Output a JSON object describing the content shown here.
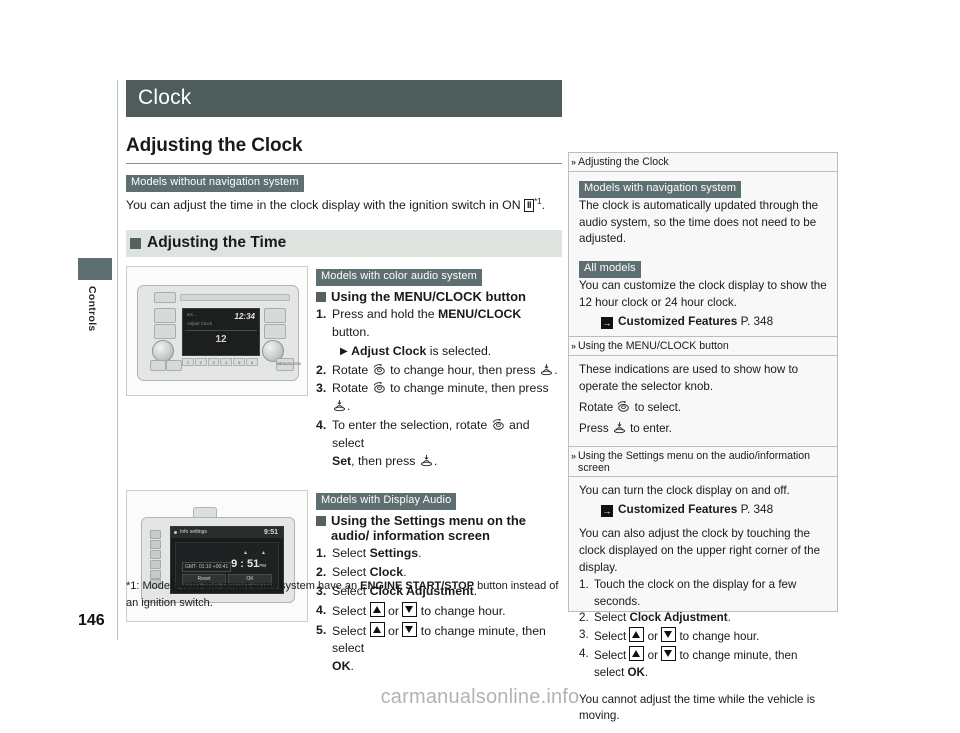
{
  "page": {
    "number": "146",
    "side_tab": "Controls",
    "chapter": "Clock",
    "watermark": "carmanualsonline.info"
  },
  "main": {
    "section_title": "Adjusting the Clock",
    "tag_without_nav": "Models without navigation system",
    "intro_pre": "You can adjust the time in the clock display with the ignition switch in ON ",
    "intro_box": "II",
    "intro_fn": "*1",
    "intro_post": ".",
    "subsection_title": "Adjusting the Time",
    "block_color_audio": {
      "tag": "Models with color audio system",
      "heading": "Using the MENU/CLOCK button",
      "steps": [
        {
          "num": "1.",
          "pre": "Press and hold the ",
          "bold": "MENU/CLOCK",
          "post": " button."
        },
        {
          "num": "2.",
          "pre": "Rotate ",
          "icon": "selector-knob-rotate-icon",
          "post": " to change hour, then press ",
          "icon2": "selector-knob-press-icon",
          "tail": "."
        },
        {
          "num": "3.",
          "pre": "Rotate ",
          "icon": "selector-knob-rotate-icon",
          "post": " to change minute, then press ",
          "icon2": "selector-knob-press-icon",
          "tail": "."
        },
        {
          "num": "4.",
          "pre": "To enter the selection, rotate ",
          "icon": "selector-knob-rotate-icon",
          "post": " and select ",
          "bold": "Set",
          "tail": ", then press ",
          "icon2": "selector-knob-press-icon",
          "end": "."
        }
      ],
      "substep_pre": "",
      "substep_bold": "Adjust Clock",
      "substep_post": " is selected."
    },
    "block_display_audio": {
      "tag": "Models with Display Audio",
      "heading": "Using the Settings menu on the audio/ information screen",
      "steps": [
        {
          "num": "1.",
          "pre": "Select ",
          "bold": "Settings",
          "post": "."
        },
        {
          "num": "2.",
          "pre": "Select ",
          "bold": "Clock",
          "post": "."
        },
        {
          "num": "3.",
          "pre": "Select ",
          "bold": "Clock Adjustment",
          "post": "."
        },
        {
          "num": "4.",
          "pre": "Select ",
          "updown": true,
          "post": " to change hour."
        },
        {
          "num": "5.",
          "pre": "Select ",
          "updown": true,
          "post": " to change minute, then select ",
          "bold": "OK",
          "tail": "."
        }
      ]
    },
    "footnote_pre": "*1: Models with the smart entry system have an ",
    "footnote_bold": "ENGINE START/STOP",
    "footnote_post": " button instead of an ignition switch."
  },
  "illustrations": {
    "color_audio": {
      "screen_time": "12:34",
      "screen_label": "Adjust Clock",
      "screen_icon": "src…",
      "screen_center": "12",
      "presets": [
        "1",
        "2",
        "3",
        "4",
        "5",
        "6"
      ],
      "menu_button": "MENU/CLOCK"
    },
    "display_audio": {
      "bar_title": "Info settings",
      "bar_time": "9:51",
      "gmt": "GMT- 01:10 +00:41",
      "clock": "9 : 51",
      "clock_suffix": "PM",
      "reset_label": "Reset",
      "ok_label": "OK"
    }
  },
  "aside": {
    "groups": [
      {
        "head": "Adjusting the Clock",
        "blocks": [
          {
            "type": "tag",
            "text": "Models with navigation system"
          },
          {
            "type": "p",
            "text": "The clock is automatically updated through the audio system, so the time does not need to be adjusted."
          },
          {
            "type": "gap"
          },
          {
            "type": "tag",
            "text": "All models"
          },
          {
            "type": "p",
            "text": "You can customize the clock display to show the 12 hour clock or 24 hour clock."
          },
          {
            "type": "ref",
            "bold": "Customized Features",
            "page": "P. 348"
          }
        ]
      },
      {
        "head": "Using the MENU/CLOCK button",
        "blocks": [
          {
            "type": "p",
            "text": "These indications are used to show how to operate the selector knob."
          },
          {
            "type": "p_icon",
            "pre": "Rotate ",
            "icon": "selector-knob-rotate-icon",
            "post": " to select."
          },
          {
            "type": "p_icon",
            "pre": "Press ",
            "icon": "selector-knob-press-icon",
            "post": " to enter."
          }
        ]
      },
      {
        "head": "Using the Settings menu on the audio/information screen",
        "blocks": [
          {
            "type": "p",
            "text": "You can turn the clock display on and off."
          },
          {
            "type": "ref",
            "bold": "Customized Features",
            "page": "P. 348"
          },
          {
            "type": "gap"
          },
          {
            "type": "p",
            "text": "You can also adjust the clock by touching the clock displayed on the upper right corner of the display."
          },
          {
            "type": "ol",
            "items": [
              {
                "num": "1.",
                "pre": "Touch the clock on the display for a few seconds."
              },
              {
                "num": "2.",
                "pre": "Select ",
                "bold": "Clock Adjustment",
                "post": "."
              },
              {
                "num": "3.",
                "pre": "Select ",
                "updown": true,
                "post": " to change hour."
              },
              {
                "num": "4.",
                "pre": "Select ",
                "updown": true,
                "post": " to change minute, then select ",
                "bold": "OK",
                "tail": "."
              }
            ]
          },
          {
            "type": "gap"
          },
          {
            "type": "p",
            "text": "You cannot adjust the time while the vehicle is moving."
          }
        ]
      }
    ]
  },
  "colors": {
    "header_bar": "#4e5c5b",
    "tag_bg": "#5e6f72",
    "subsection_bg": "#dfe3e0",
    "aside_bg": "#f7f8f7",
    "rule": "#b9bfbd"
  }
}
